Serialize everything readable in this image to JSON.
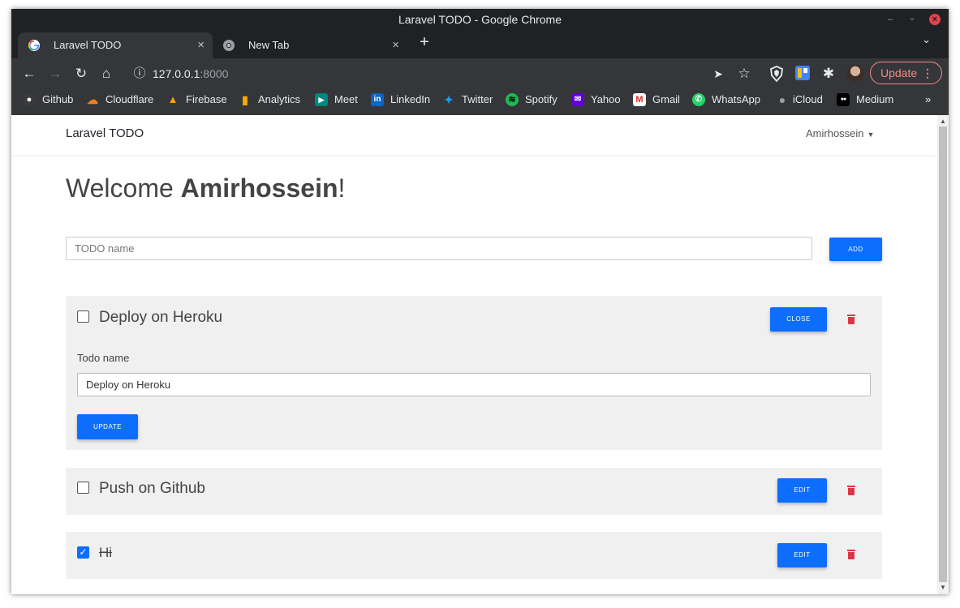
{
  "window": {
    "title": "Laravel TODO - Google Chrome",
    "minimize_glyph": "–",
    "maximize_glyph": "▫",
    "close_glyph": "×"
  },
  "tabs": [
    {
      "label": "Laravel TODO",
      "icon": "google-icon",
      "active": true
    },
    {
      "label": "New Tab",
      "icon": "chrome-icon",
      "active": false
    }
  ],
  "tab_close_glyph": "×",
  "new_tab_glyph": "+",
  "tab_list_glyph": "⌄",
  "toolbar": {
    "back_glyph": "←",
    "forward_glyph": "→",
    "reload_glyph": "↻",
    "home_glyph": "⌂",
    "info_glyph": "ⓘ",
    "url_host": "127.0.0.1",
    "url_port": ":8000",
    "send_glyph": "➤",
    "star_glyph": "☆",
    "extensions_glyph": "✱",
    "update_label": "Update",
    "menu_glyph": "⋮"
  },
  "bookmarks": [
    {
      "label": "Github",
      "icon": "github-icon",
      "color": "#3a3a3a",
      "glyph": "●"
    },
    {
      "label": "Cloudflare",
      "icon": "cloudflare-icon",
      "color": "#f38020",
      "glyph": "☁"
    },
    {
      "label": "Firebase",
      "icon": "firebase-icon",
      "color": "#ffa000",
      "glyph": "▲"
    },
    {
      "label": "Analytics",
      "icon": "analytics-icon",
      "color": "#f9ab00",
      "glyph": "▮"
    },
    {
      "label": "Meet",
      "icon": "meet-icon",
      "color": "#00897b",
      "glyph": "▶"
    },
    {
      "label": "LinkedIn",
      "icon": "linkedin-icon",
      "color": "#0a66c2",
      "glyph": "in"
    },
    {
      "label": "Twitter",
      "icon": "twitter-icon",
      "color": "#1d9bf0",
      "glyph": "✦"
    },
    {
      "label": "Spotify",
      "icon": "spotify-icon",
      "color": "#1db954",
      "glyph": "≋"
    },
    {
      "label": "Yahoo",
      "icon": "yahoo-icon",
      "color": "#6001d2",
      "glyph": "✉"
    },
    {
      "label": "Gmail",
      "icon": "gmail-icon",
      "color": "#d93025",
      "glyph": "M"
    },
    {
      "label": "WhatsApp",
      "icon": "whatsapp-icon",
      "color": "#25d366",
      "glyph": "✆"
    },
    {
      "label": "iCloud",
      "icon": "apple-icon",
      "color": "#555555",
      "glyph": "●"
    },
    {
      "label": "Medium",
      "icon": "medium-icon",
      "color": "#000000",
      "glyph": "●●"
    }
  ],
  "bookmarks_more_glyph": "»",
  "page": {
    "brand": "Laravel TODO",
    "user_name": "Amirhossein",
    "user_caret": "▼",
    "welcome_prefix": "Welcome ",
    "welcome_name": "Amirhossein",
    "welcome_suffix": "!",
    "todo_placeholder": "TODO name",
    "add_label": "ADD",
    "edit_field_label": "Todo name",
    "edit_field_value": "Deploy on Heroku",
    "update_label": "UPDATE",
    "todos": [
      {
        "title": "Deploy on Heroku",
        "done": false,
        "action_label": "CLOSE"
      },
      {
        "title": "Push on Github",
        "done": false,
        "action_label": "EDIT"
      },
      {
        "title": "Hi",
        "done": true,
        "action_label": "EDIT"
      }
    ],
    "check_glyph": "✓"
  },
  "colors": {
    "primary": "#0d6efd",
    "danger": "#dc3545",
    "chrome_dark": "#202124",
    "chrome_toolbar": "#35363a",
    "update_accent": "#f28b82"
  }
}
